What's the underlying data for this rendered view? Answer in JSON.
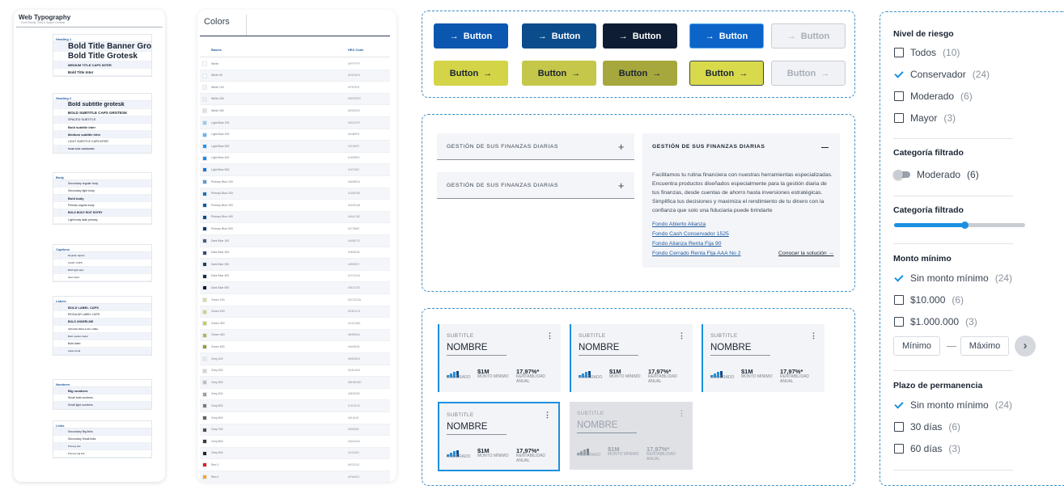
{
  "typography": {
    "title": "Web Typography",
    "subtitle": "Font Family: Grid & Space Grotesk",
    "sections": [
      {
        "name": "Heading 1",
        "rows": [
          {
            "t": "Bold Title Banner Grotesk",
            "s": 10,
            "w": "bold"
          },
          {
            "t": "Bold Title Grotesk",
            "s": 10,
            "w": "bold"
          },
          {
            "t": "MEDIUM TITLE CAPS INTER",
            "s": 4,
            "w": "bold"
          },
          {
            "t": "Bold Title Inter",
            "s": 4.5,
            "w": "bold"
          }
        ]
      },
      {
        "name": "Heading 2",
        "rows": [
          {
            "t": "Bold subtitle grotesk",
            "s": 7,
            "w": "bold"
          },
          {
            "t": "BOLD SUBTITLE CAPS GROTESK",
            "s": 4.5,
            "w": "bold"
          },
          {
            "t": "SPACED SUBTITLE",
            "s": 3.8,
            "w": "normal"
          },
          {
            "t": "Bold subtitle Inter",
            "s": 4,
            "w": "bold"
          },
          {
            "t": "Medium subtitle Inter",
            "s": 4,
            "w": "bold"
          },
          {
            "t": "LIGHT SUBTITLE CAPS INTER",
            "s": 3.5,
            "w": "normal"
          },
          {
            "t": "Small bold subtitle/title",
            "s": 3,
            "w": "bold"
          }
        ]
      },
      {
        "name": "Body",
        "rows": [
          {
            "t": "Secondary regular body",
            "s": 3.5,
            "w": "normal"
          },
          {
            "t": "Secondary light body",
            "s": 3.5,
            "w": "normal"
          },
          {
            "t": "Bold body",
            "s": 4,
            "w": "bold"
          },
          {
            "t": "Primary regular body",
            "s": 3.5,
            "w": "normal"
          },
          {
            "t": "BOLD BODY EDIT ENTRY",
            "s": 3.5,
            "w": "bold"
          },
          {
            "t": "Light body italic primary",
            "s": 3.5,
            "w": "normal"
          }
        ]
      },
      {
        "name": "Captions",
        "rows": [
          {
            "t": "Regular caption",
            "s": 3,
            "w": "normal"
          },
          {
            "t": "LIGHT CAPS",
            "s": 3,
            "w": "normal"
          },
          {
            "t": "Bold light caps",
            "s": 3,
            "w": "normal"
          },
          {
            "t": "Semi-bold",
            "s": 3,
            "w": "normal"
          }
        ]
      },
      {
        "name": "Labels",
        "rows": [
          {
            "t": "BOLD LABEL CAPS",
            "s": 4,
            "w": "bold"
          },
          {
            "t": "REGULAR LABEL CAPS",
            "s": 3.5,
            "w": "normal"
          },
          {
            "t": "BOLD UNDERLINE",
            "s": 3.5,
            "w": "bold"
          },
          {
            "t": "SPACED REGULAR LABEL",
            "s": 3,
            "w": "normal"
          },
          {
            "t": "Bold medium label",
            "s": 3,
            "w": "normal"
          },
          {
            "t": "Bold label",
            "s": 3.5,
            "w": "normal"
          },
          {
            "t": "Label small",
            "s": 3,
            "w": "normal"
          }
        ]
      },
      {
        "name": "Numbers",
        "rows": [
          {
            "t": "Big numbers",
            "s": 4,
            "w": "bold"
          },
          {
            "t": "Small bold numbers",
            "s": 3.5,
            "w": "normal"
          },
          {
            "t": "Small light numbers",
            "s": 3.5,
            "w": "normal"
          }
        ]
      },
      {
        "name": "Links",
        "rows": [
          {
            "t": "Secondary Big links",
            "s": 3.5,
            "w": "normal"
          },
          {
            "t": "Secondary Small links",
            "s": 3.5,
            "w": "normal"
          },
          {
            "t": "Primary link",
            "s": 3,
            "w": "normal"
          },
          {
            "t": "Primary big link",
            "s": 3,
            "w": "normal"
          }
        ]
      }
    ]
  },
  "colors": {
    "tab": "Colors",
    "head_name": "Basics",
    "head_hex": "HEX Code",
    "rows": [
      {
        "n": "White",
        "c": "#FFFFFF"
      },
      {
        "n": "White 50",
        "c": "#FAFAFA"
      },
      {
        "n": "White 100",
        "c": "#F5F5F5"
      },
      {
        "n": "White 200",
        "c": "#EEEEEE"
      },
      {
        "n": "White 300",
        "c": "#E0E0E0"
      },
      {
        "n": "Light Blue 100",
        "c": "#90CAF9"
      },
      {
        "n": "Light Blue 200",
        "c": "#64B5F6"
      },
      {
        "n": "Light Blue 300",
        "c": "#2196F3"
      },
      {
        "n": "Light Blue 400",
        "c": "#1E88E5"
      },
      {
        "n": "Light Blue 500",
        "c": "#1976D2"
      },
      {
        "n": "Primary Blue 100",
        "c": "#5A9BD4"
      },
      {
        "n": "Primary Blue 200",
        "c": "#1D6FB8"
      },
      {
        "n": "Primary Blue 300",
        "c": "#0D5DA8"
      },
      {
        "n": "Primary Blue 400",
        "c": "#0A4C8C"
      },
      {
        "n": "Primary Blue 500",
        "c": "#073B6E"
      },
      {
        "n": "Dark Blue 100",
        "c": "#4A5E78"
      },
      {
        "n": "Dark Blue 200",
        "c": "#3B4E68"
      },
      {
        "n": "Dark Blue 300",
        "c": "#2B3E57"
      },
      {
        "n": "Dark Blue 400",
        "c": "#1C2D44"
      },
      {
        "n": "Dark Blue 500",
        "c": "#0E1D33"
      },
      {
        "n": "Green 100",
        "c": "#DCDC9A"
      },
      {
        "n": "Green 200",
        "c": "#D3D47A"
      },
      {
        "n": "Green 300",
        "c": "#C9CA5E"
      },
      {
        "n": "Green 400",
        "c": "#B4B54A"
      },
      {
        "n": "Green 500",
        "c": "#9A9B36"
      },
      {
        "n": "Grey 100",
        "c": "#E6E6E6"
      },
      {
        "n": "Grey 200",
        "c": "#D4D4D4"
      },
      {
        "n": "Grey 300",
        "c": "#BDBDBD"
      },
      {
        "n": "Grey 400",
        "c": "#9E9E9E"
      },
      {
        "n": "Grey 500",
        "c": "#7A7A7A"
      },
      {
        "n": "Grey 600",
        "c": "#616161"
      },
      {
        "n": "Grey 700",
        "c": "#505050"
      },
      {
        "n": "Grey 800",
        "c": "#3A3A3A"
      },
      {
        "n": "Grey 900",
        "c": "#242424"
      },
      {
        "n": "Red 1",
        "c": "#E02020"
      },
      {
        "n": "Red 2",
        "c": "#F5A623"
      }
    ]
  },
  "buttons": {
    "label": "Button",
    "row1": [
      {
        "bg": "#0B57B0",
        "fg": "#FFFFFF",
        "bd": "#0B57B0"
      },
      {
        "bg": "#0A4C8C",
        "fg": "#FFFFFF",
        "bd": "#0A4C8C"
      },
      {
        "bg": "#0E1D33",
        "fg": "#FFFFFF",
        "bd": "#0E1D33"
      },
      {
        "bg": "#0D64C8",
        "fg": "#FFFFFF",
        "bd": "#4AA8F0"
      },
      {
        "bg": "#F1F2F5",
        "fg": "#A8AEB6",
        "bd": "#C9CDD3"
      }
    ],
    "row2": [
      {
        "bg": "#D3D447",
        "fg": "#1A2432",
        "bd": "#D3D447"
      },
      {
        "bg": "#C5C74A",
        "fg": "#1A2432",
        "bd": "#C5C74A"
      },
      {
        "bg": "#A6A73C",
        "fg": "#1A2432",
        "bd": "#A6A73C"
      },
      {
        "bg": "#D8DA4C",
        "fg": "#1A2432",
        "bd": "#3A4552"
      },
      {
        "bg": "#F1F2F5",
        "fg": "#A8AEB6",
        "bd": "#C9CDD3"
      }
    ]
  },
  "accordion": {
    "title": "GESTIÓN DE SUS FINANZAS DIARIAS",
    "body": [
      "Facilitamos tu rutina financiera con nuestras herramientas especializadas.",
      "Encuentra productos diseñados especialmente para la gestión diaria de",
      "tus finanzas, desde cuentas de ahorro hasta inversiones estratégicas.",
      "Simplifica tus decisiones y maximiza el rendimiento de tu dinero con la",
      "confianza que solo una fiduciaria puede brindarte"
    ],
    "links": [
      "Fondo Abierto Alianza",
      "Fondo Cash Conservador 1525",
      "Fondo Alianza Renta Fija 90",
      "Fondo Cerrado Renta Fija AAA No 2"
    ],
    "cta": "Conocer la solución →"
  },
  "cards": {
    "subtitle": "SUBTITLE",
    "name": "NOMBRE",
    "risk": "MODERADO",
    "amount": "$1M",
    "amount_label": "MONTO MÍNIMO",
    "rate": "17,97%*",
    "rate_label1": "RENTABILIDAD",
    "rate_label2": "ANUAL"
  },
  "filters": {
    "risk": {
      "title": "Nivel de riesgo",
      "items": [
        {
          "l": "Todos",
          "c": "(10)",
          "on": false
        },
        {
          "l": "Conservador",
          "c": "(24)",
          "on": true
        },
        {
          "l": "Moderado",
          "c": "(6)",
          "on": false
        },
        {
          "l": "Mayor",
          "c": "(3)",
          "on": false
        }
      ]
    },
    "cat1": {
      "title": "Categoría filtrado",
      "label": "Moderado",
      "count": "(6)"
    },
    "cat2": {
      "title": "Categoría filtrado",
      "value": 0.54
    },
    "monto": {
      "title": "Monto mínimo",
      "items": [
        {
          "l": "Sin monto mínimo",
          "c": "(24)",
          "on": true
        },
        {
          "l": "$10.000",
          "c": "(6)",
          "on": false
        },
        {
          "l": "$1.000.000",
          "c": "(3)",
          "on": false
        }
      ],
      "min": "Mínimo",
      "max": "Máximo"
    },
    "plazo": {
      "title": "Plazo de permanencia",
      "items": [
        {
          "l": "Sin monto mínimo",
          "c": "(24)",
          "on": true
        },
        {
          "l": "30 días",
          "c": "(6)",
          "on": false
        },
        {
          "l": "60 días",
          "c": "(3)",
          "on": false
        }
      ]
    }
  }
}
